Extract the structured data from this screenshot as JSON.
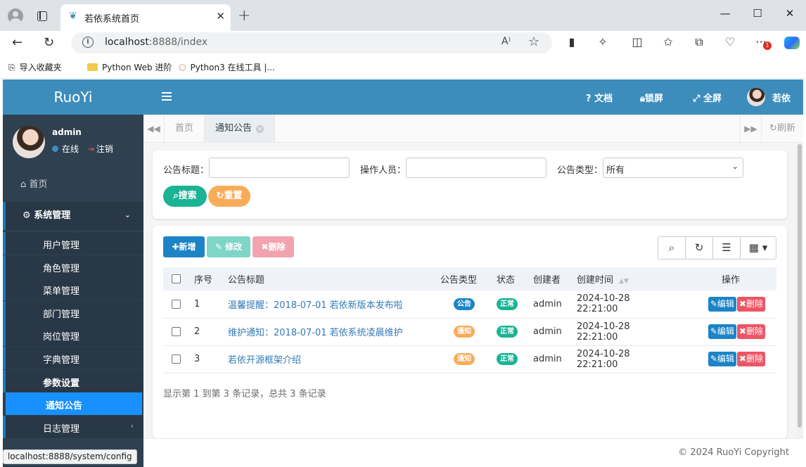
{
  "browser": {
    "tab_title": "若依系统首页",
    "url_host": "localhost",
    "url_rest": ":8888/index",
    "bookmarks": [
      {
        "label": "导入收藏夹"
      },
      {
        "label": "Python Web 进阶"
      },
      {
        "label": "Python3 在线工具 |..."
      }
    ],
    "status_url": "localhost:8888/system/config"
  },
  "sidebar": {
    "logo": "RuoYi",
    "user": {
      "name": "admin",
      "online": "在线",
      "logout": "注销"
    },
    "home": "首页",
    "system": "系统管理",
    "items": [
      {
        "label": "用户管理"
      },
      {
        "label": "角色管理"
      },
      {
        "label": "菜单管理"
      },
      {
        "label": "部门管理"
      },
      {
        "label": "岗位管理"
      },
      {
        "label": "字典管理"
      },
      {
        "label": "参数设置"
      },
      {
        "label": "通知公告"
      },
      {
        "label": "日志管理"
      }
    ]
  },
  "topbar": {
    "docs": "文档",
    "lock": "锁屏",
    "fullscreen": "全屏",
    "user": "若依"
  },
  "tabs": {
    "home": "首页",
    "active": "通知公告",
    "refresh": "刷新"
  },
  "search": {
    "title_label": "公告标题：",
    "operator_label": "操作人员：",
    "type_label": "公告类型：",
    "type_value": "所有",
    "search_btn": "搜索",
    "reset_btn": "重置"
  },
  "toolbar": {
    "add": "新增",
    "edit": "修改",
    "delete": "删除"
  },
  "table": {
    "headers": {
      "seq": "序号",
      "title": "公告标题",
      "type": "公告类型",
      "status": "状态",
      "creator": "创建者",
      "time": "创建时间",
      "ops": "操作"
    },
    "rows": [
      {
        "seq": "1",
        "title": "温馨提醒：2018-07-01 若依新版本发布啦",
        "type": "公告",
        "status": "正常",
        "creator": "admin",
        "time": "2024-10-28 22:21:00",
        "edit": "编辑",
        "del": "删除"
      },
      {
        "seq": "2",
        "title": "维护通知：2018-07-01 若依系统凌晨维护",
        "type": "通知",
        "status": "正常",
        "creator": "admin",
        "time": "2024-10-28 22:21:00",
        "edit": "编辑",
        "del": "删除"
      },
      {
        "seq": "3",
        "title": "若依开源框架介绍",
        "type": "通知",
        "status": "正常",
        "creator": "admin",
        "time": "2024-10-28 22:21:00",
        "edit": "编辑",
        "del": "删除"
      }
    ],
    "pager": "显示第 1 到第 3 条记录，总共 3 条记录"
  },
  "footer": "© 2024 RuoYi Copyright"
}
